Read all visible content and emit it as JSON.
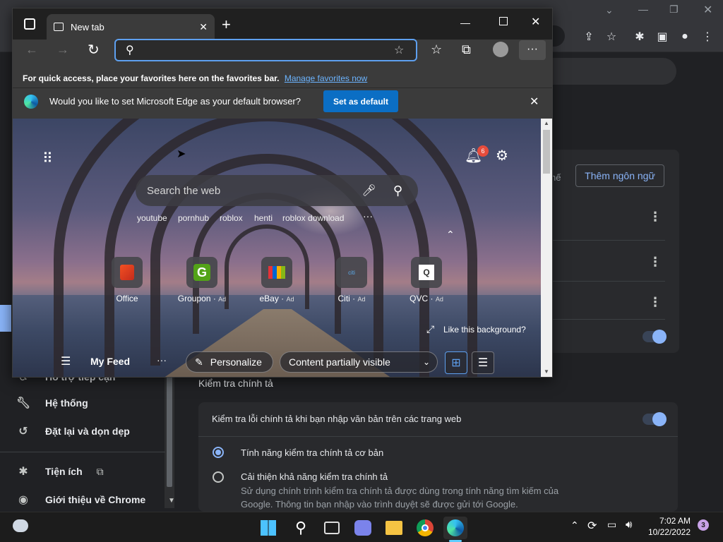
{
  "edge": {
    "tab_title": "New tab",
    "favorites_bar_text": "For quick access, place your favorites here on the favorites bar.",
    "manage_favorites_link": "Manage favorites now",
    "infobar_text": "Would you like to set Microsoft Edge as your default browser?",
    "set_default_label": "Set as default",
    "ntp": {
      "search_placeholder": "Search the web",
      "notification_count": "6",
      "trending": [
        "youtube",
        "pornhub",
        "roblox",
        "henti",
        "roblox download"
      ],
      "tiles": [
        {
          "label": "Office",
          "ad": ""
        },
        {
          "label": "Groupon",
          "ad": "Ad"
        },
        {
          "label": "eBay",
          "ad": "Ad"
        },
        {
          "label": "Citi",
          "ad": "Ad"
        },
        {
          "label": "QVC",
          "ad": "Ad"
        }
      ],
      "like_background": "Like this background?",
      "my_feed": "My Feed",
      "personalize": "Personalize",
      "content_visibility": "Content partially visible"
    }
  },
  "chrome_settings": {
    "add_language_button": "Thêm ngôn ngữ",
    "truncated_text": "hế",
    "sidebar": [
      {
        "label": "Hỗ trợ tiếp cận",
        "icon": "accessibility-icon"
      },
      {
        "label": "Hệ thống",
        "icon": "wrench-icon"
      },
      {
        "label": "Đặt lại và dọn dẹp",
        "icon": "history-icon"
      },
      {
        "label": "Tiện ích",
        "icon": "puzzle-icon"
      },
      {
        "label": "Giới thiệu về Chrome",
        "icon": "chrome-icon"
      }
    ],
    "spellcheck_section_title": "Kiểm tra chính tả",
    "spellcheck_toggle_label": "Kiểm tra lỗi chính tả khi bạn nhập văn bản trên các trang web",
    "basic_spellcheck": "Tính năng kiểm tra chính tả cơ bản",
    "enhanced_spellcheck": "Cải thiện khả năng kiểm tra chính tả",
    "enhanced_desc_1": "Sử dụng chính trình kiểm tra chính tả được dùng trong tính năng tìm kiếm của",
    "enhanced_desc_2": "Google. Thông tin bạn nhập vào trình duyệt sẽ được gửi tới Google."
  },
  "taskbar": {
    "time": "7:02 AM",
    "date": "10/22/2022",
    "notification_count": "3"
  },
  "colors": {
    "edge_accent": "#0b6ec4",
    "chrome_accent": "#8ab4f8",
    "notification_badge": "#e74c3c"
  }
}
